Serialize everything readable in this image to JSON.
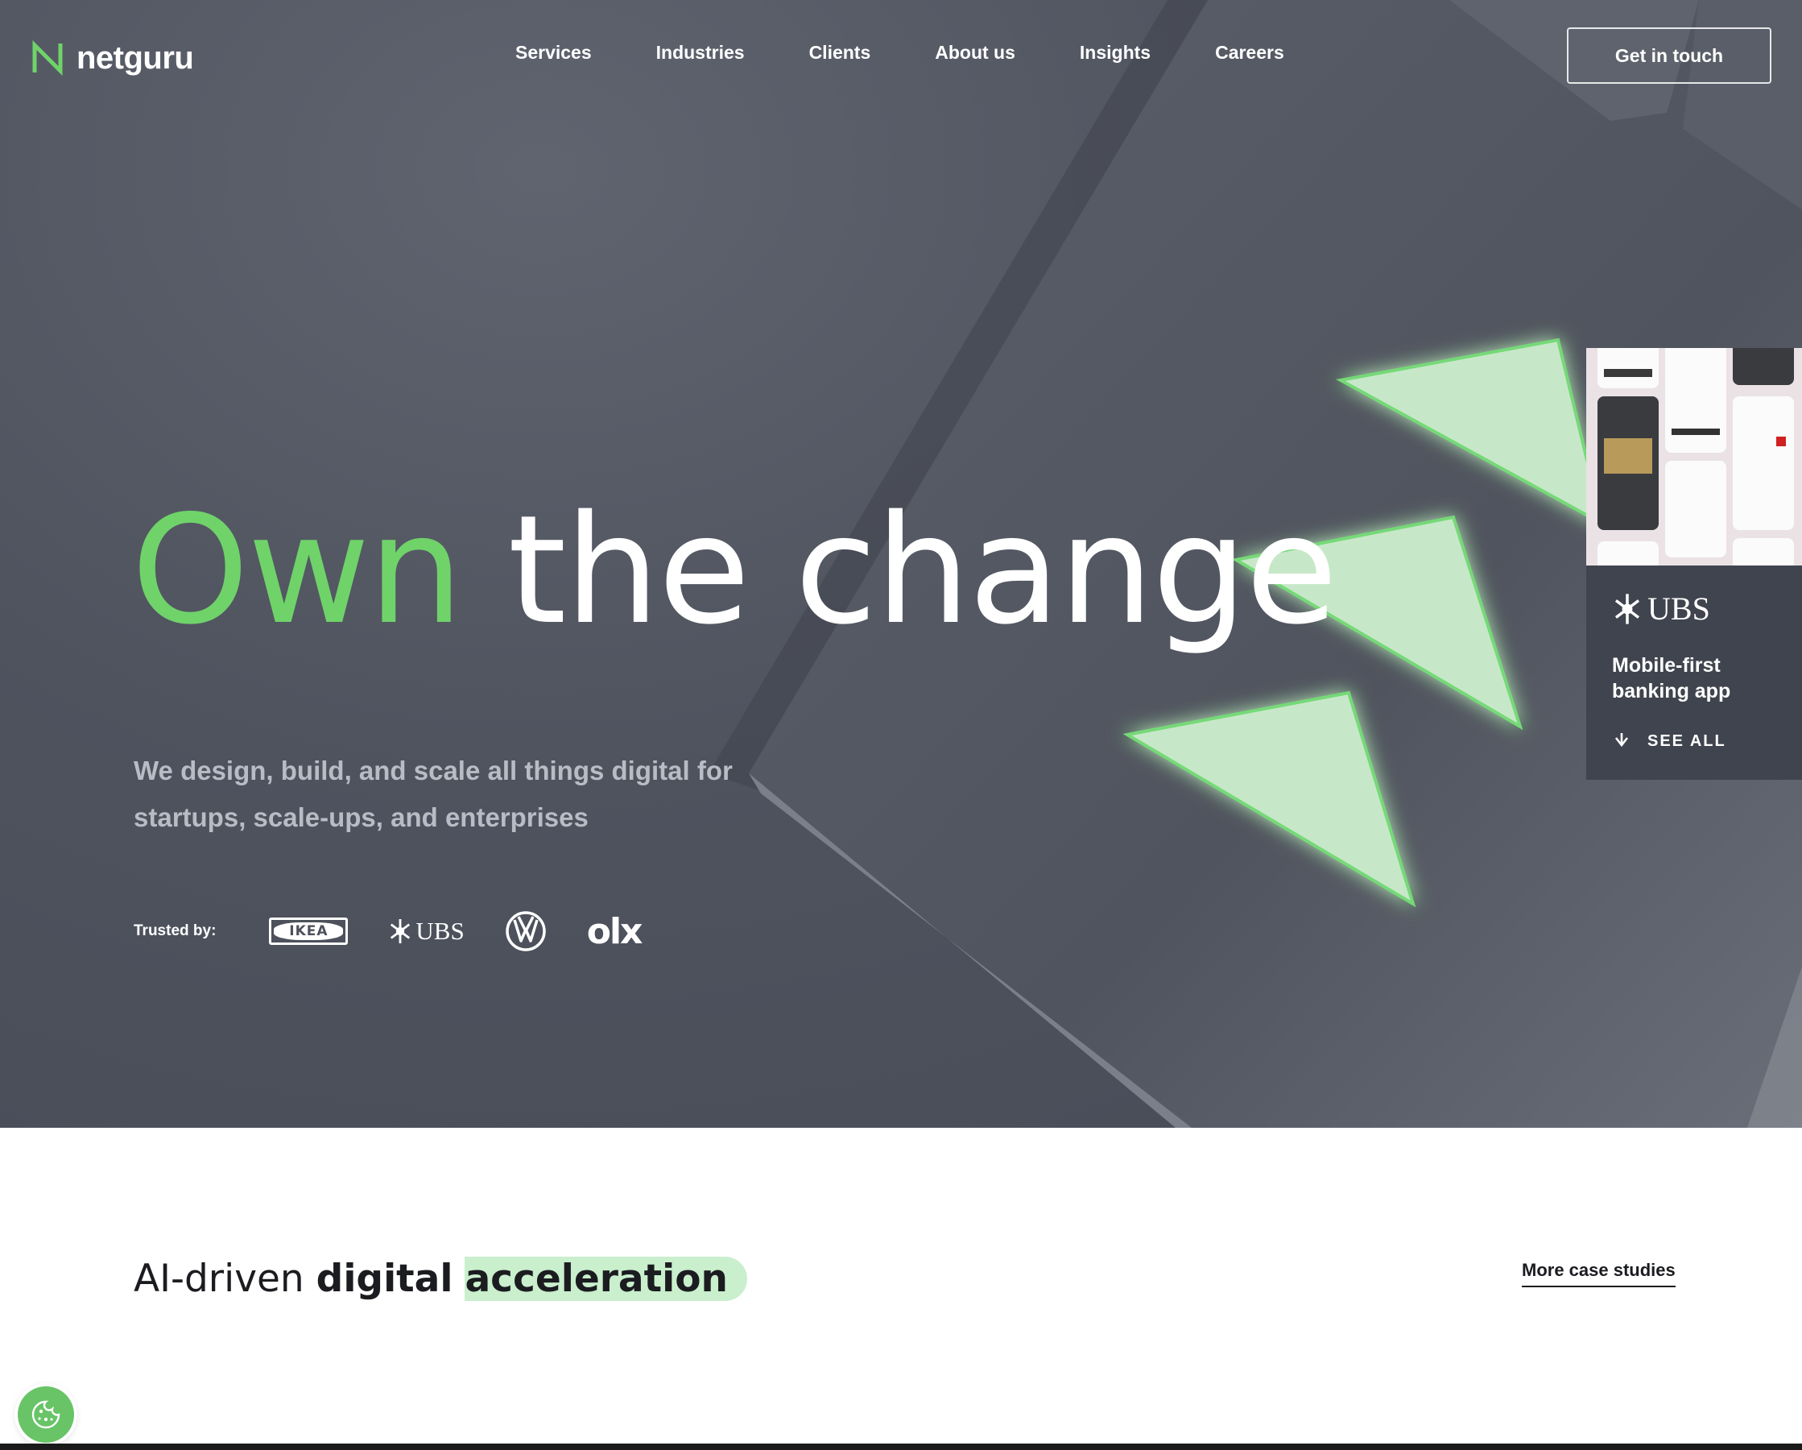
{
  "brand": {
    "name": "netguru"
  },
  "nav": {
    "items": [
      "Services",
      "Industries",
      "Clients",
      "About us",
      "Insights",
      "Careers"
    ],
    "cta": "Get in touch"
  },
  "hero": {
    "headline_accent": "Own",
    "headline_rest": "the change",
    "subhead": "We design, build, and scale all things digital for startups, scale-ups, and enterprises",
    "trusted_label": "Trusted by:",
    "trusted_logos": [
      {
        "name": "IKEA",
        "icon": "ikea-logo"
      },
      {
        "name": "UBS",
        "icon": "ubs-logo"
      },
      {
        "name": "VW",
        "icon": "volkswagen-logo"
      },
      {
        "name": "olx",
        "icon": "olx-logo"
      }
    ]
  },
  "case_card": {
    "brand": "UBS",
    "title": "Mobile-first banking app",
    "see_all": "SEE ALL"
  },
  "section": {
    "heading_light": "AI-driven",
    "heading_bold_1": "digital",
    "heading_bold_2": "acceleration",
    "more_link": "More case studies"
  },
  "colors": {
    "accent_green": "#6fd36a",
    "hero_bg": "#4f535e",
    "highlight": "#c9efcd",
    "card_bg": "#40444e"
  },
  "icons": {
    "cookie": "cookie-icon",
    "see_all": "arrow-down-icon"
  }
}
